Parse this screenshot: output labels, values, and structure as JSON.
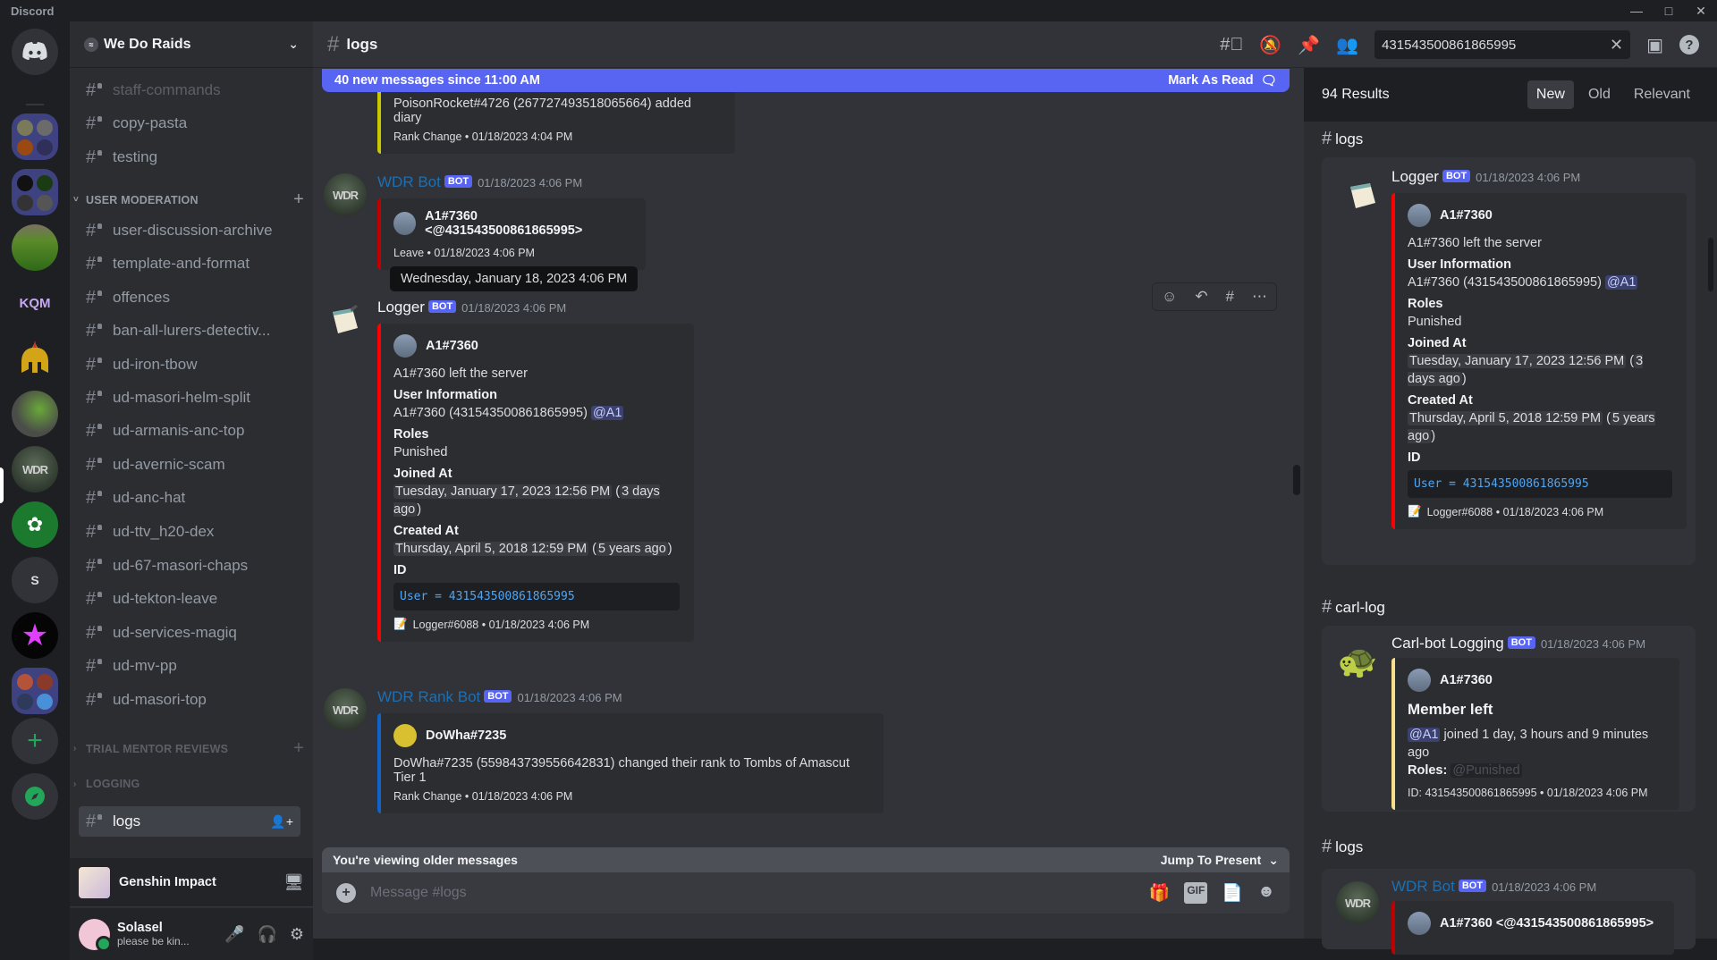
{
  "app": {
    "title": "Discord",
    "window_controls": [
      "minimize",
      "maximize",
      "close"
    ]
  },
  "guilds": [
    {
      "name": "home",
      "icon": "discord-logo"
    },
    {
      "name": "folder-1",
      "type": "folder"
    },
    {
      "name": "folder-2",
      "type": "folder"
    },
    {
      "name": "cornfield-server"
    },
    {
      "name": "KQM"
    },
    {
      "name": "spartan-helm-server"
    },
    {
      "name": "osrs-map-server"
    },
    {
      "name": "WDR",
      "selected": true
    },
    {
      "name": "brain-server"
    },
    {
      "name": "S",
      "label": "S"
    },
    {
      "name": "rainbow-star-server"
    },
    {
      "name": "folder-3",
      "type": "folder"
    },
    {
      "name": "add-server",
      "icon": "plus"
    },
    {
      "name": "explore",
      "icon": "compass"
    }
  ],
  "server": {
    "name": "We Do Raids"
  },
  "channels": [
    {
      "label": "staff-commands",
      "state": "muted"
    },
    {
      "label": "copy-pasta"
    },
    {
      "label": "testing"
    },
    {
      "category": "USER MODERATION"
    },
    {
      "label": "user-discussion-archive"
    },
    {
      "label": "template-and-format"
    },
    {
      "label": "offences"
    },
    {
      "label": "ban-all-lurers-detectiv..."
    },
    {
      "label": "ud-iron-tbow"
    },
    {
      "label": "ud-masori-helm-split"
    },
    {
      "label": "ud-armanis-anc-top"
    },
    {
      "label": "ud-avernic-scam"
    },
    {
      "label": "ud-anc-hat"
    },
    {
      "label": "ud-ttv_h20-dex"
    },
    {
      "label": "ud-67-masori-chaps"
    },
    {
      "label": "ud-tekton-leave"
    },
    {
      "label": "ud-services-magiq"
    },
    {
      "label": "ud-mv-pp"
    },
    {
      "label": "ud-masori-top"
    },
    {
      "category": "TRIAL MENTOR REVIEWS"
    },
    {
      "category": "LOGGING"
    },
    {
      "label": "logs",
      "state": "active"
    }
  ],
  "activity": {
    "game": "Genshin Impact"
  },
  "user": {
    "name": "Solasel",
    "status": "please be kin...",
    "presence": "online"
  },
  "header": {
    "channel": "logs",
    "search_value": "431543500861865995"
  },
  "banner": {
    "text": "40 new messages since 11:00 AM",
    "action": "Mark As Read"
  },
  "messages": [
    {
      "partial": true,
      "embed_desc": "PoisonRocket#4726 (267727493518065664) added diary",
      "footer": "Rank Change • 01/18/2023 4:04 PM",
      "color": "#c9c900"
    },
    {
      "author": "WDR Bot",
      "bot": "BOT",
      "time": "01/18/2023 4:06 PM",
      "author_color": "#1f6fb0",
      "embed_author": "A1#7360  <@431543500861865995>",
      "footer": "Leave • 01/18/2023 4:06 PM",
      "color": "#c00000"
    },
    {
      "author": "Logger",
      "bot": "BOT",
      "time": "01/18/2023 4:06 PM",
      "author_color": "#f2f3f5",
      "embed_author": "A1#7360",
      "desc": "A1#7360 left the server",
      "fields": {
        "user_info_label": "User Information",
        "user_info": "A1#7360 (431543500861865995)",
        "mention": "@A1",
        "roles_label": "Roles",
        "roles": "Punished",
        "joined_label": "Joined At",
        "joined": "Tuesday, January 17, 2023 12:56 PM",
        "joined_rel": "3 days ago",
        "created_label": "Created At",
        "created": "Thursday, April 5, 2018 12:59 PM",
        "created_rel": "5 years ago",
        "id_label": "ID",
        "id_code": "User = 431543500861865995"
      },
      "footer": "Logger#6088 • 01/18/2023 4:06 PM",
      "color": "#ff0000"
    },
    {
      "author": "WDR Rank Bot",
      "bot": "BOT",
      "time": "01/18/2023 4:06 PM",
      "author_color": "#1f6fb0",
      "embed_author": "DoWha#7235",
      "desc": "DoWha#7235 (559843739556642831) changed their rank to Tombs of Amascut Tier 1",
      "footer": "Rank Change • 01/18/2023 4:06 PM",
      "color": "#1063c9"
    }
  ],
  "tooltip": "Wednesday, January 18, 2023 4:06 PM",
  "hover_actions": [
    "add-reaction",
    "reply",
    "create-thread",
    "more"
  ],
  "older": {
    "text": "You're viewing older messages",
    "jump": "Jump To Present"
  },
  "composer": {
    "placeholder": "Message #logs"
  },
  "results": {
    "count": "94 Results",
    "tabs": [
      "New",
      "Old",
      "Relevant"
    ],
    "active_tab": "New",
    "groups": [
      {
        "channel": "logs",
        "author": "Logger",
        "bot": "BOT",
        "time": "01/18/2023 4:06 PM",
        "embed_author": "A1#7360",
        "desc": "A1#7360 left the server",
        "user_info_label": "User Information",
        "user_info": "A1#7360 (431543500861865995)",
        "mention": "@A1",
        "roles_label": "Roles",
        "roles": "Punished",
        "joined_label": "Joined At",
        "joined": "Tuesday, January 17, 2023 12:56 PM",
        "joined_rel": "3 days ago",
        "created_label": "Created At",
        "created": "Thursday, April 5, 2018 12:59 PM",
        "created_rel": "5 years ago",
        "id_label": "ID",
        "id_code": "User = 431543500861865995",
        "footer": "Logger#6088 • 01/18/2023 4:06 PM"
      },
      {
        "channel": "carl-log",
        "author": "Carl-bot Logging",
        "bot": "BOT",
        "time": "01/18/2023 4:06 PM",
        "embed_author": "A1#7360",
        "title": "Member left",
        "mention": "@A1",
        "joined_text": "joined 1 day, 3 hours and 9 minutes ago",
        "roles_label": "Roles:",
        "roles": "@Punished",
        "footer": "ID: 431543500861865995 • 01/18/2023 4:06 PM"
      },
      {
        "channel": "logs",
        "author": "WDR Bot",
        "bot": "BOT",
        "time": "01/18/2023 4:06 PM",
        "embed_author": "A1#7360  <@431543500861865995>"
      }
    ]
  }
}
